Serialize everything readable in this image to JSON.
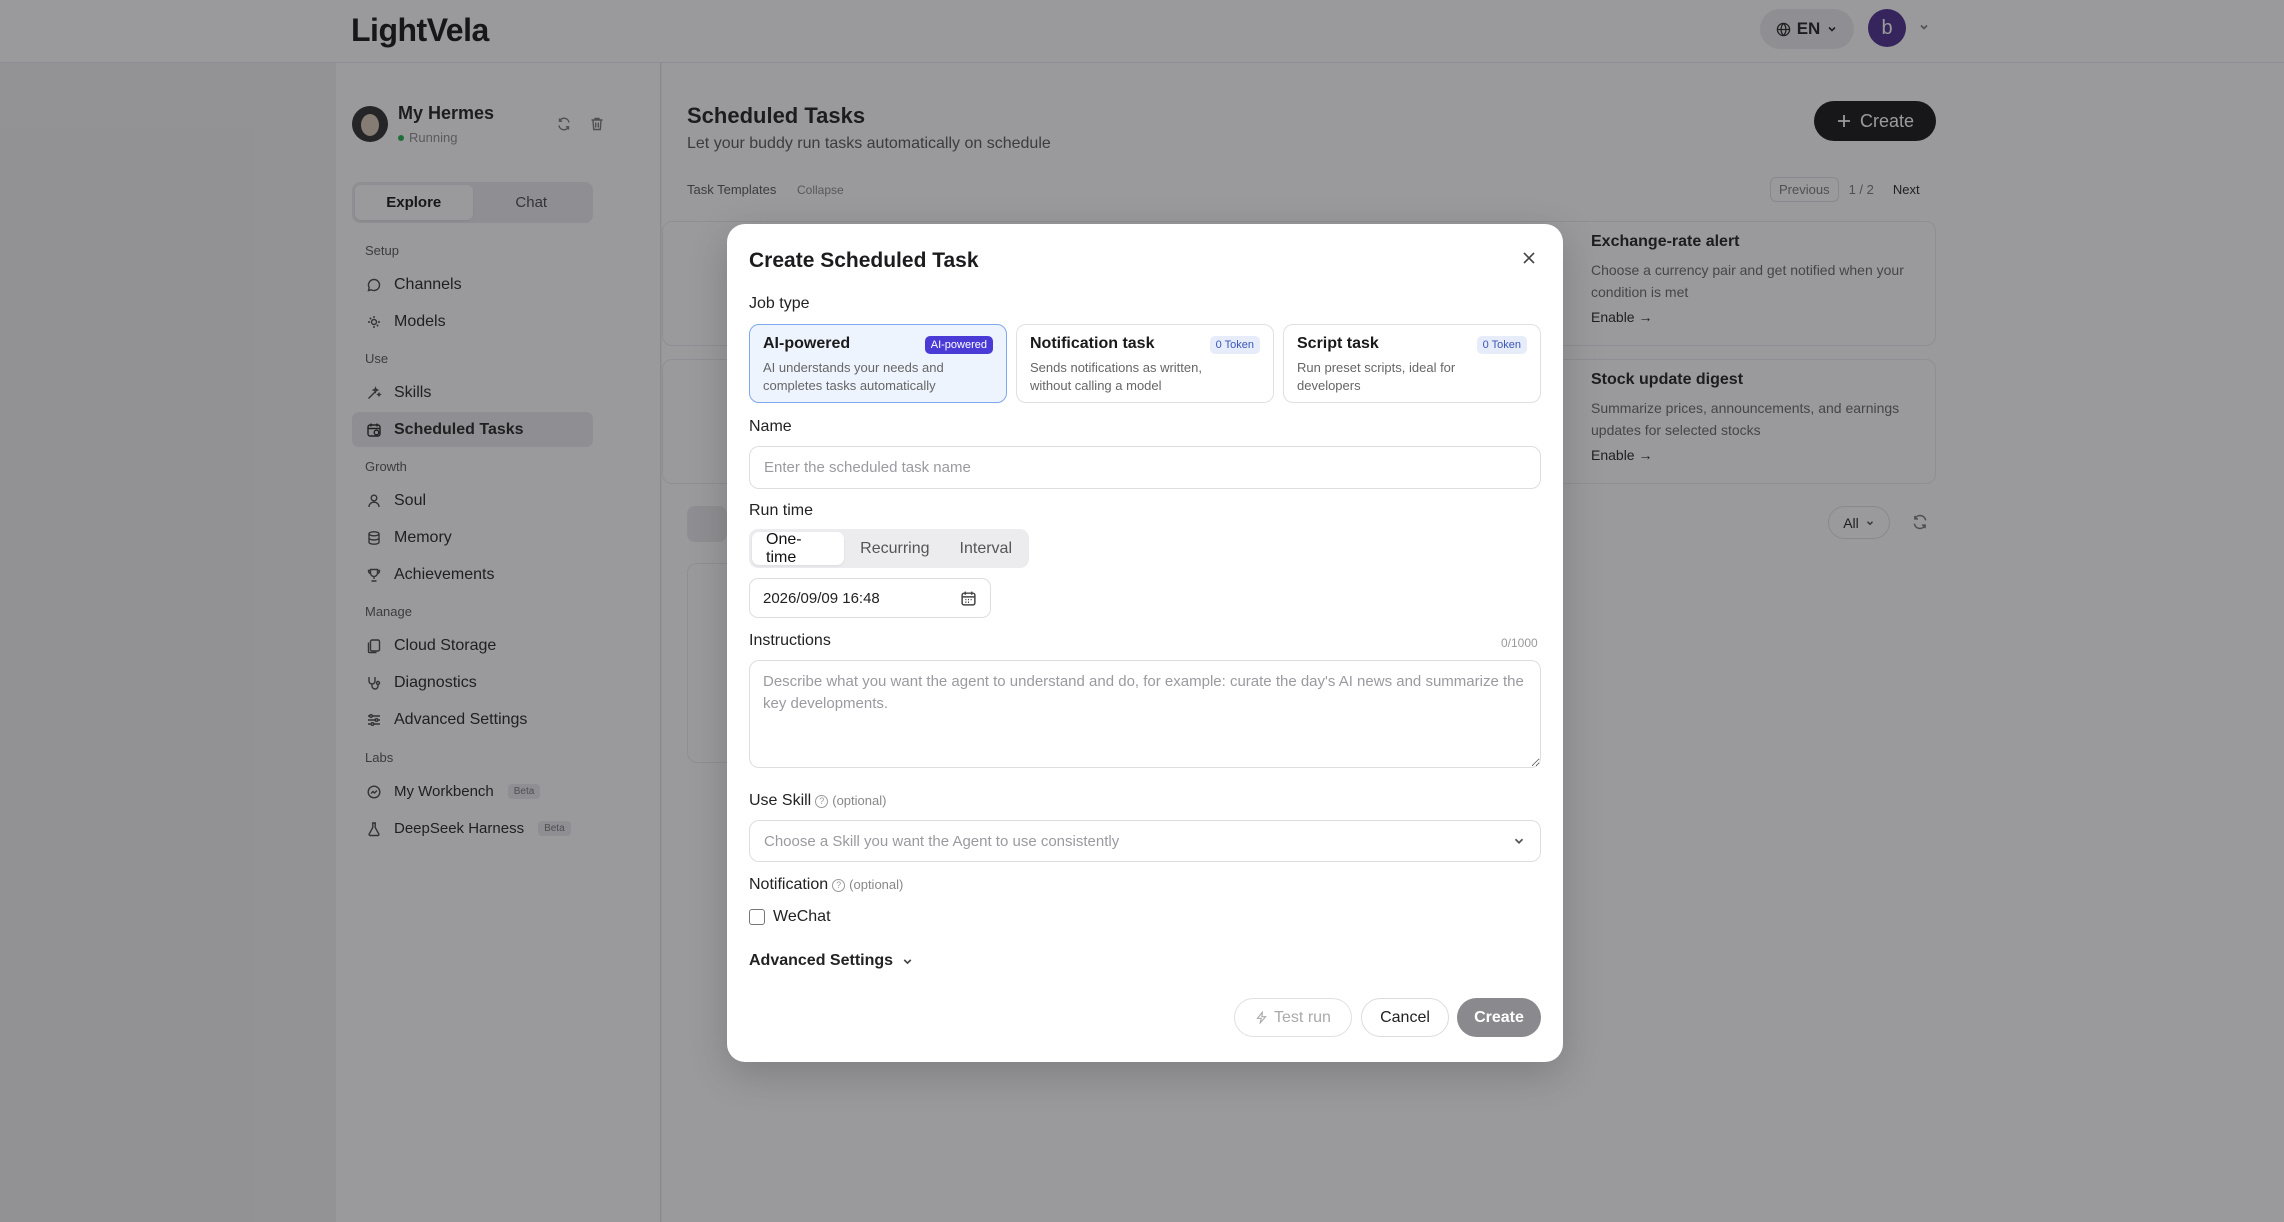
{
  "topbar": {
    "logo": "LightVela",
    "lang": "EN",
    "avatar_letter": "b"
  },
  "sidebar": {
    "agent_name": "My Hermes",
    "agent_status": "Running",
    "tabs": [
      "Explore",
      "Chat"
    ],
    "sections": {
      "setup": "Setup",
      "use": "Use",
      "growth": "Growth",
      "manage": "Manage",
      "labs": "Labs"
    },
    "items": {
      "channels": "Channels",
      "models": "Models",
      "skills": "Skills",
      "scheduled_tasks": "Scheduled Tasks",
      "soul": "Soul",
      "memory": "Memory",
      "achievements": "Achievements",
      "cloud_storage": "Cloud Storage",
      "diagnostics": "Diagnostics",
      "advanced_settings": "Advanced Settings",
      "my_workbench": "My Workbench",
      "deepseek_harness": "DeepSeek Harness"
    },
    "beta_label": "Beta"
  },
  "main": {
    "title": "Scheduled Tasks",
    "subtitle": "Let your buddy run tasks automatically on schedule",
    "create_label": "Create",
    "templates_label": "Task Templates",
    "collapse_label": "Collapse",
    "pager": {
      "previous": "Previous",
      "page": "1 / 2",
      "next": "Next"
    },
    "template_cards": [
      {
        "title": "Exchange-rate alert",
        "desc": "Choose a currency pair and get notified when your condition is met",
        "enable": "Enable"
      },
      {
        "title": "Stock update digest",
        "desc": "Summarize prices, announcements, and earnings updates for selected stocks",
        "enable": "Enable"
      }
    ],
    "filter_all": "All"
  },
  "modal": {
    "title": "Create Scheduled Task",
    "job_type_label": "Job type",
    "job_types": [
      {
        "title": "AI-powered",
        "badge": "AI-powered",
        "desc": "AI understands your needs and completes tasks automatically"
      },
      {
        "title": "Notification task",
        "badge": "0 Token",
        "desc": "Sends notifications as written, without calling a model"
      },
      {
        "title": "Script task",
        "badge": "0 Token",
        "desc": "Run preset scripts, ideal for developers"
      }
    ],
    "name_label": "Name",
    "name_placeholder": "Enter the scheduled task name",
    "run_time_label": "Run time",
    "run_time_options": [
      "One-time",
      "Recurring",
      "Interval"
    ],
    "datetime": "2026/09/09 16:48",
    "instructions_label": "Instructions",
    "instructions_counter": "0/1000",
    "instructions_placeholder": "Describe what you want the agent to understand and do, for example: curate the day's AI news and summarize the key developments.",
    "use_skill_label": "Use Skill",
    "optional_label": "(optional)",
    "skill_placeholder": "Choose a Skill you want the Agent to use consistently",
    "notification_label": "Notification",
    "wechat_label": "WeChat",
    "advanced_settings_label": "Advanced Settings",
    "test_run_label": "Test run",
    "cancel_label": "Cancel",
    "create_label": "Create"
  }
}
